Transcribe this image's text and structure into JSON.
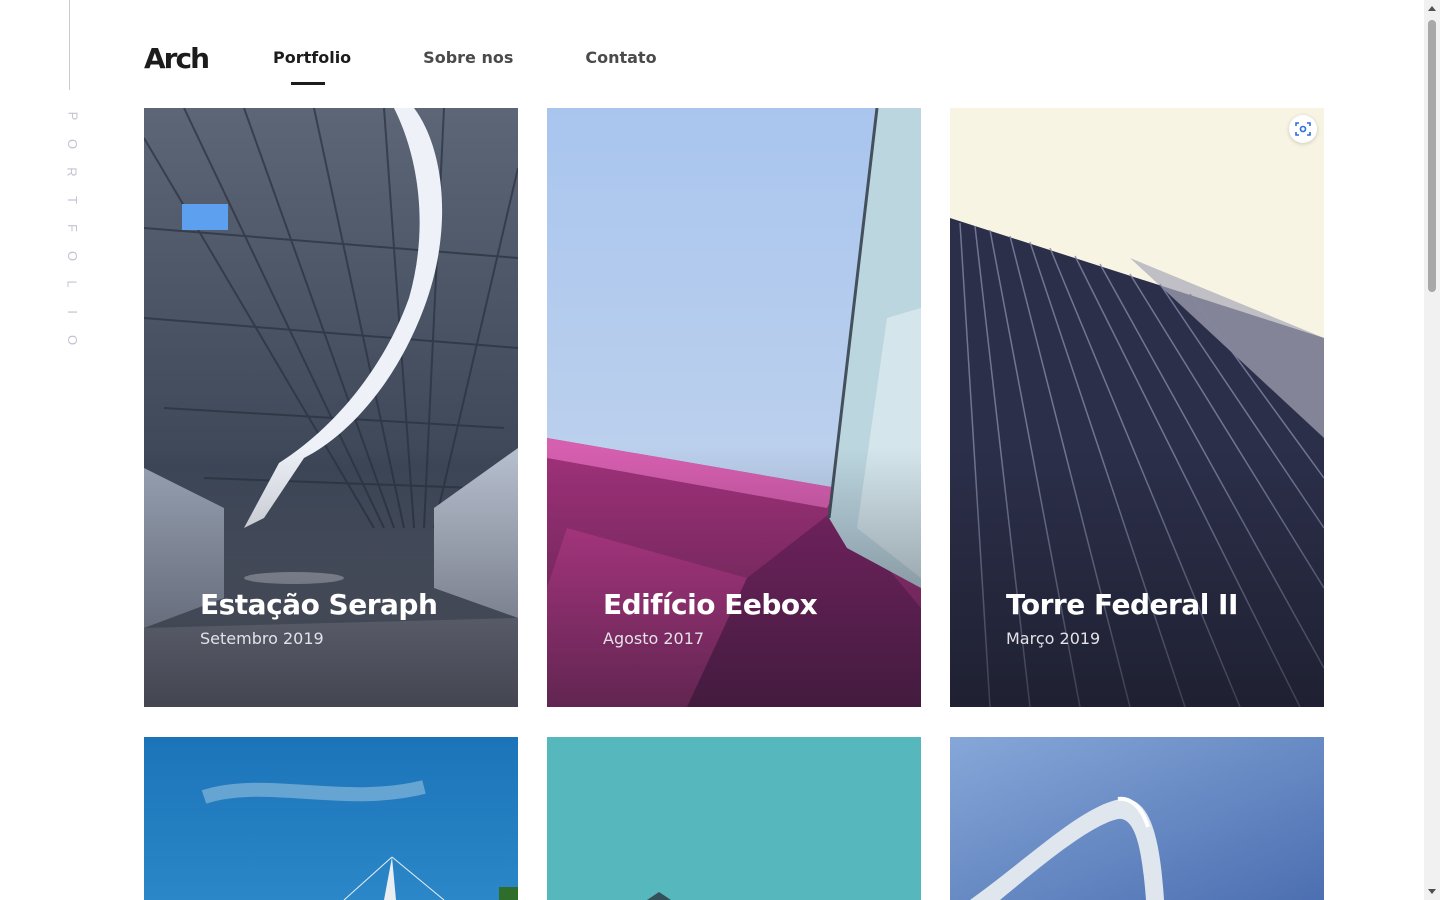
{
  "logo": "Arch",
  "side_label_letters": [
    "P",
    "O",
    "R",
    "T",
    "F",
    "O",
    "L",
    "I",
    "O"
  ],
  "nav": [
    {
      "label": "Portfolio",
      "active": true
    },
    {
      "label": "Sobre nos",
      "active": false
    },
    {
      "label": "Contato",
      "active": false
    }
  ],
  "projects": [
    {
      "title": "Estação Seraph",
      "date": "Setembro 2019"
    },
    {
      "title": "Edifício Eebox",
      "date": "Agosto 2017"
    },
    {
      "title": "Torre Federal II",
      "date": "Março 2019"
    }
  ],
  "icons": {
    "scan": "scan-icon"
  },
  "colors": {
    "accent": "#1c1c1c",
    "side_label": "#c5c3d0"
  }
}
